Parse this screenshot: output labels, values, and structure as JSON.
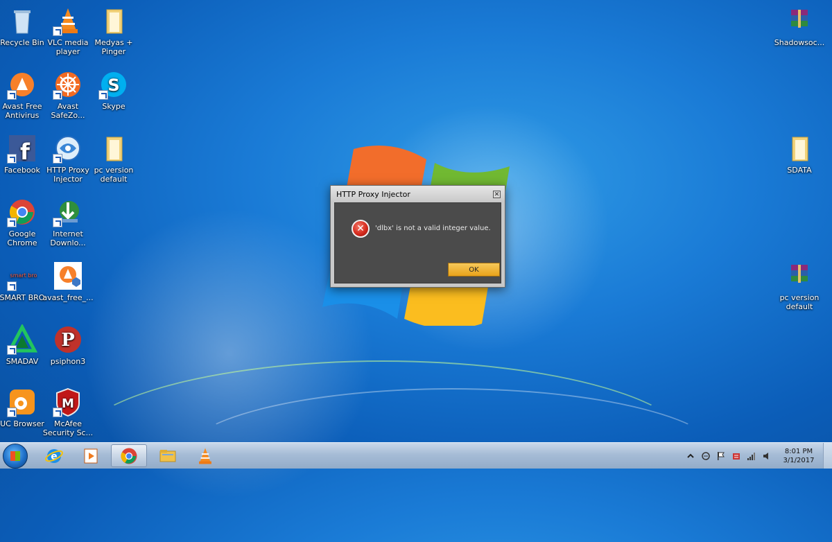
{
  "desktop": {
    "icons_left": [
      {
        "id": "recycle-bin",
        "label": "Recycle Bin",
        "shortcut": false,
        "icon": "recycle-bin-icon"
      },
      {
        "id": "vlc",
        "label": "VLC media player",
        "shortcut": true,
        "icon": "vlc-cone-icon"
      },
      {
        "id": "medyas",
        "label": "Medyas + Pinger",
        "shortcut": false,
        "icon": "folder-icon"
      },
      {
        "id": "avast-free",
        "label": "Avast Free Antivirus",
        "shortcut": true,
        "icon": "avast-icon"
      },
      {
        "id": "avast-safezone",
        "label": "Avast SafeZo...",
        "shortcut": true,
        "icon": "avast-safezone-icon"
      },
      {
        "id": "skype",
        "label": "Skype",
        "shortcut": true,
        "icon": "skype-icon"
      },
      {
        "id": "facebook",
        "label": "Facebook",
        "shortcut": true,
        "icon": "facebook-icon"
      },
      {
        "id": "http-proxy-injector",
        "label": "HTTP Proxy Injector",
        "shortcut": true,
        "icon": "http-proxy-injector-icon"
      },
      {
        "id": "pc-version-default-left",
        "label": "pc version default",
        "shortcut": false,
        "icon": "folder-icon"
      },
      {
        "id": "google-chrome",
        "label": "Google Chrome",
        "shortcut": true,
        "icon": "chrome-icon"
      },
      {
        "id": "internet-download",
        "label": "Internet Downlo...",
        "shortcut": true,
        "icon": "idm-icon"
      },
      {
        "id": "smart-bro",
        "label": "SMART BRO",
        "shortcut": true,
        "icon": "smart-bro-icon"
      },
      {
        "id": "avast-free-installer",
        "label": "avast_free_...",
        "shortcut": false,
        "icon": "avast-installer-icon"
      },
      {
        "id": "smadav",
        "label": "SMADAV",
        "shortcut": true,
        "icon": "smadav-icon"
      },
      {
        "id": "psiphon3",
        "label": "psiphon3",
        "shortcut": false,
        "icon": "psiphon-icon"
      },
      {
        "id": "uc-browser",
        "label": "UC Browser",
        "shortcut": true,
        "icon": "uc-browser-icon"
      },
      {
        "id": "mcafee",
        "label": "McAfee Security Sc...",
        "shortcut": true,
        "icon": "mcafee-icon"
      }
    ],
    "icons_right": [
      {
        "id": "shadowsocks",
        "label": "Shadowsoc...",
        "icon": "winrar-archive-icon"
      },
      {
        "id": "sdata",
        "label": "SDATA",
        "icon": "folder-icon"
      },
      {
        "id": "pc-version-default-right",
        "label": "pc version default",
        "icon": "winrar-archive-icon"
      }
    ]
  },
  "dialog": {
    "title": "HTTP Proxy Injector",
    "close_glyph": "✕",
    "message": "'dlbx' is not a valid integer value.",
    "ok_label": "OK",
    "icon": "error-icon"
  },
  "taskbar": {
    "pinned": [
      {
        "id": "internet-explorer",
        "icon": "internet-explorer-icon",
        "active": false
      },
      {
        "id": "media-player",
        "icon": "media-player-icon",
        "active": false
      },
      {
        "id": "chrome",
        "icon": "chrome-icon",
        "active": true
      },
      {
        "id": "explorer",
        "icon": "folder-icon",
        "active": false
      },
      {
        "id": "vlc",
        "icon": "vlc-cone-icon",
        "active": false
      }
    ],
    "clock": {
      "time": "8:01 PM",
      "date": "3/1/2017"
    }
  }
}
